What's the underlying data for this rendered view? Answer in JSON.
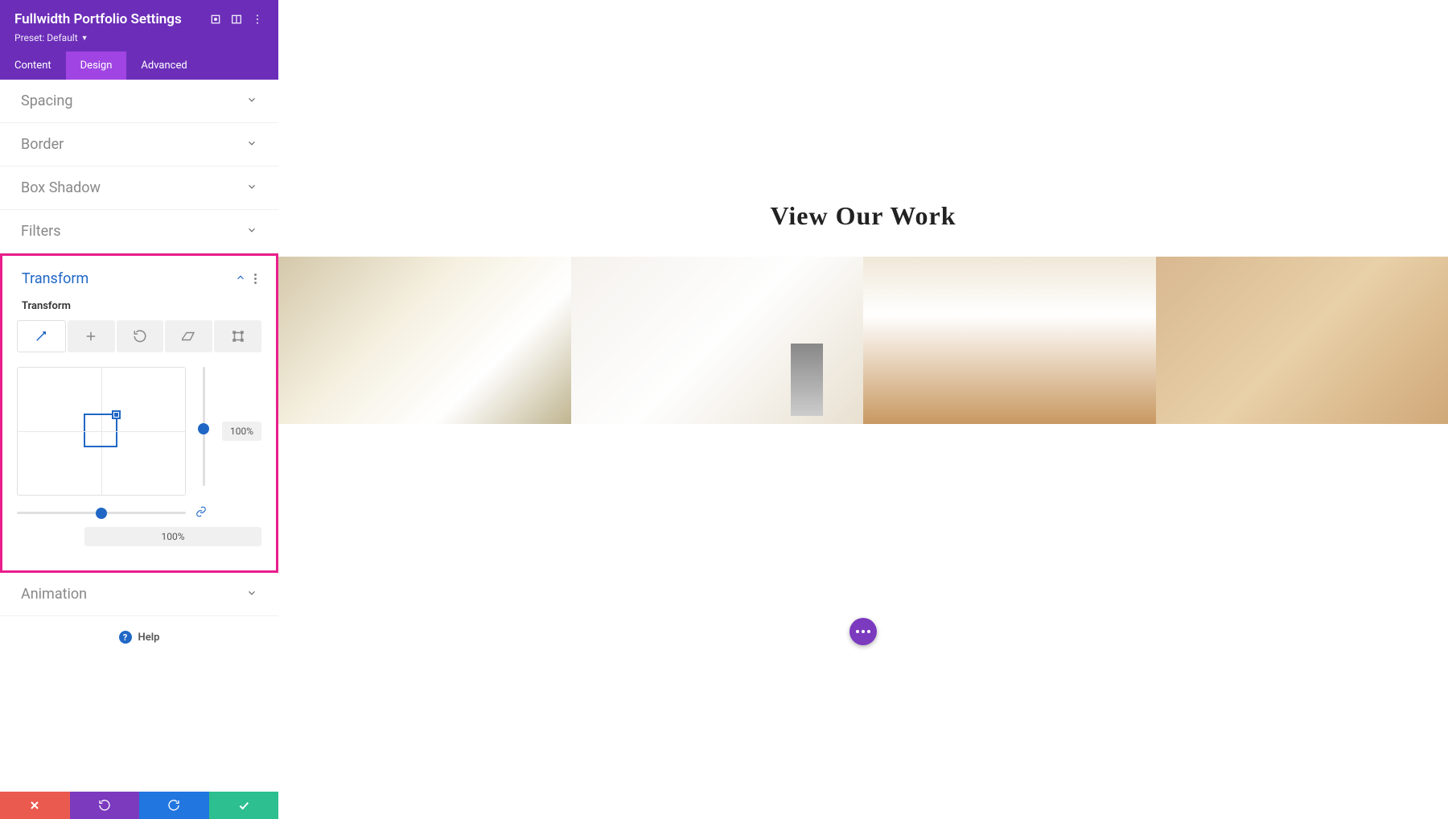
{
  "header": {
    "title": "Fullwidth Portfolio Settings",
    "preset_label": "Preset: Default"
  },
  "tabs": {
    "content": "Content",
    "design": "Design",
    "advanced": "Advanced"
  },
  "sections": {
    "spacing": "Spacing",
    "border": "Border",
    "box_shadow": "Box Shadow",
    "filters": "Filters",
    "transform": "Transform",
    "animation": "Animation"
  },
  "transform": {
    "sublabel": "Transform",
    "v_value": "100%",
    "h_value": "100%"
  },
  "help": "Help",
  "canvas": {
    "heading": "View Our Work"
  }
}
